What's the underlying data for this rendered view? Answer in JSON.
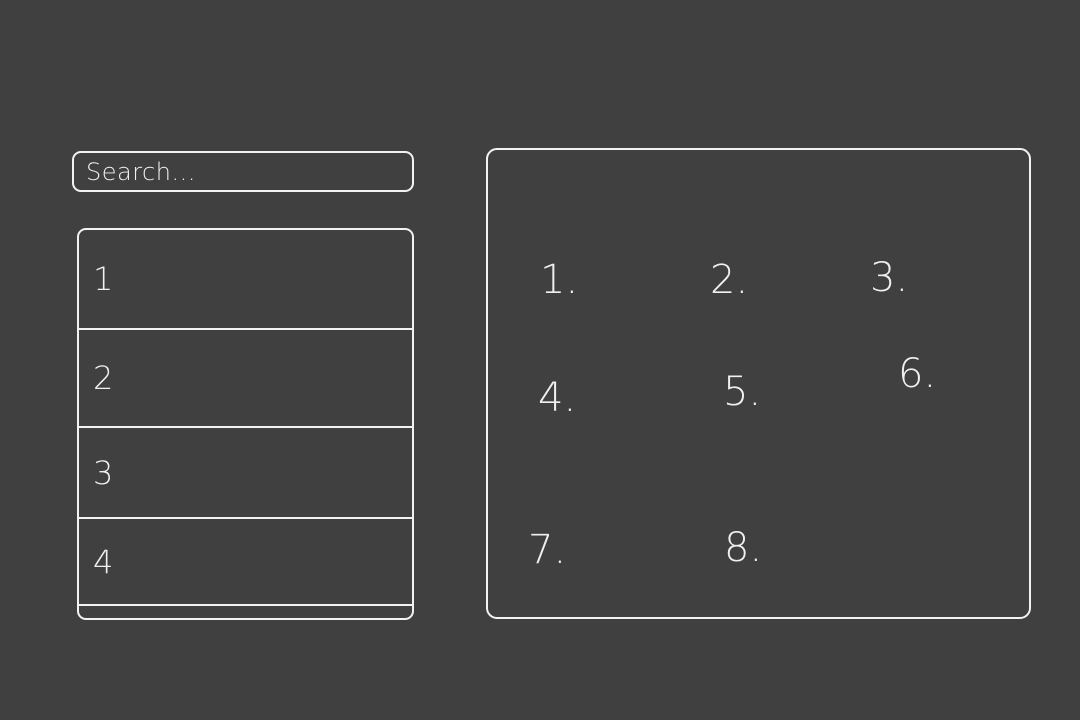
{
  "search": {
    "placeholder": "Search..."
  },
  "list": {
    "items": [
      {
        "label": "1"
      },
      {
        "label": "2"
      },
      {
        "label": "3"
      },
      {
        "label": "4"
      }
    ]
  },
  "grid": {
    "items": [
      {
        "label": "1."
      },
      {
        "label": "2."
      },
      {
        "label": "3."
      },
      {
        "label": "4."
      },
      {
        "label": "5."
      },
      {
        "label": "6."
      },
      {
        "label": "7."
      },
      {
        "label": "8."
      }
    ]
  },
  "colors": {
    "background": "#404040",
    "stroke": "#f2f2f2"
  }
}
